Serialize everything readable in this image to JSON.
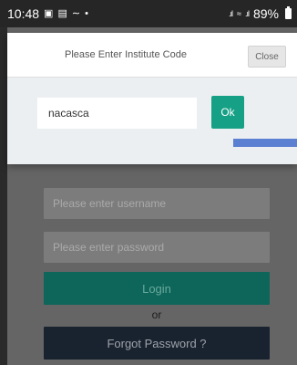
{
  "status_bar": {
    "time": "10:48",
    "battery": "89%"
  },
  "dialog": {
    "title": "Please Enter Institute Code",
    "close_label": "Close",
    "code_value": "nacasca",
    "ok_label": "Ok"
  },
  "login_form": {
    "username_placeholder": "Please enter username",
    "password_placeholder": "Please enter password",
    "login_label": "Login",
    "or_label": "or",
    "forgot_label": "Forgot Password ?"
  },
  "colors": {
    "ok_button": "#16a085",
    "login_button": "#0f6b5e",
    "forgot_button": "#1b2432",
    "accent_strip": "#5b7fd1"
  },
  "icons": [
    "image-icon",
    "screen-icon",
    "swipe-icon",
    "dot-icon",
    "signal-icon",
    "wifi-icon",
    "battery-icon"
  ]
}
